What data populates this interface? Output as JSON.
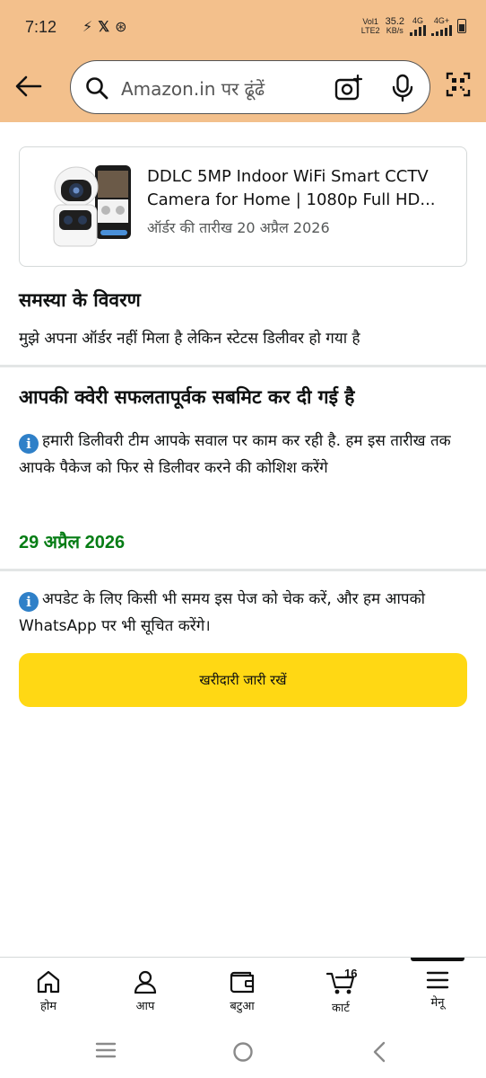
{
  "status_bar": {
    "time": "7:12",
    "notification_icons": [
      "flash-icon",
      "x-icon",
      "data-saver-icon"
    ],
    "network": {
      "volte_line1": "Vol1",
      "volte_line2": "LTE2",
      "speed_value": "35.2",
      "speed_unit": "KB/s",
      "sim1_type": "4G",
      "sim2_type": "4G+"
    }
  },
  "header": {
    "search_placeholder": "Amazon.in पर ढूंढें",
    "background_color": "#f3c08c"
  },
  "order": {
    "title": "DDLC 5MP Indoor WiFi Smart CCTV Camera for Home | 1080p Full HD...",
    "order_date": "ऑर्डर की तारीख 20 अप्रैल 2026"
  },
  "issue": {
    "heading": "समस्या के विवरण",
    "description": "मुझे अपना ऑर्डर नहीं मिला है लेकिन स्टेटस डिलीवर हो गया है"
  },
  "confirmation": {
    "heading": "आपकी क्वेरी सफलतापूर्वक सबमिट कर दी गई है",
    "info_text": "हमारी डिलीवरी टीम आपके सवाल पर काम कर रही है. हम इस तारीख तक आपके पैकेज को फिर से डिलीवर करने की कोशिश करेंगे",
    "redelivery_date": "29 अप्रैल 2026",
    "update_text": "अपडेट के लिए किसी भी समय इस पेज को चेक करें, और हम आपको WhatsApp पर भी सूचित करेंगे।",
    "info_icon": "i"
  },
  "actions": {
    "continue_shopping": "खरीदारी जारी रखें",
    "button_color": "#ffd814"
  },
  "bottom_nav": {
    "items": [
      {
        "label": "होम",
        "icon": "home-icon"
      },
      {
        "label": "आप",
        "icon": "person-icon"
      },
      {
        "label": "बटुआ",
        "icon": "wallet-icon"
      },
      {
        "label": "कार्ट",
        "icon": "cart-icon"
      },
      {
        "label": "मेनू",
        "icon": "menu-icon"
      }
    ],
    "cart_count": "16",
    "active_item": "मेनू"
  },
  "system_nav": [
    "recents-icon",
    "home-circle-icon",
    "back-chevron-icon"
  ],
  "colors": {
    "success_green": "#067d15",
    "info_blue": "#2f80c8"
  }
}
